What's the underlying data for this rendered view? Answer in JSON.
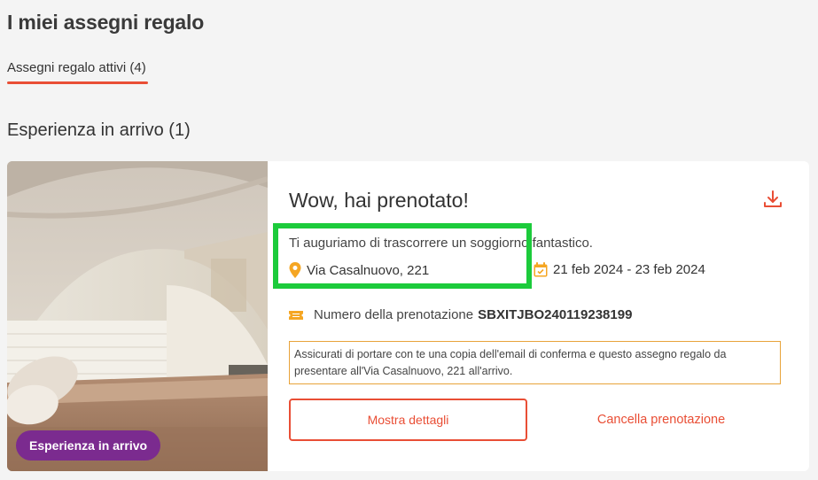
{
  "page": {
    "title": "I miei assegni regalo"
  },
  "tabs": {
    "active_label": "Assegni regalo attivi (4)"
  },
  "section": {
    "title": "Esperienza in arrivo (1)"
  },
  "card": {
    "badge": "Esperienza in arrivo",
    "heading": "Wow, hai prenotato!",
    "wish": "Ti auguriamo di trascorrere un soggiorno fantastico.",
    "address": "Via Casalnuovo, 221",
    "dates": "21 feb 2024 - 23 feb 2024",
    "booking_label": "Numero della prenotazione",
    "booking_code": "SBXITJBO240119238199",
    "notice": "Assicurati di portare con te una copia dell'email di conferma e questo assegno regalo da presentare all'Via Casalnuovo, 221 all'arrivo.",
    "details_button": "Mostra dettagli",
    "cancel_button": "Cancella prenotazione"
  },
  "icons": {
    "download": "download-icon",
    "location": "location-pin-icon",
    "calendar": "calendar-icon",
    "ticket": "ticket-icon"
  },
  "colors": {
    "accent": "#e94e35",
    "badge": "#7b2b8f",
    "notice_border": "#e8a33a",
    "icon_yellow": "#f5a623",
    "highlight": "#1ccb3b"
  }
}
